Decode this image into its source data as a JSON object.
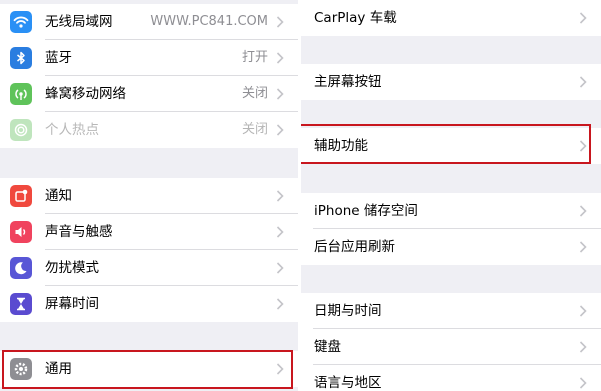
{
  "left": {
    "items": [
      {
        "label": "无线局域网",
        "value": "WWW.PC841.COM",
        "icon": "wifi-icon",
        "color": "#2a90f5"
      },
      {
        "label": "蓝牙",
        "value": "打开",
        "icon": "bluetooth-icon",
        "color": "#2a7de0"
      },
      {
        "label": "蜂窝移动网络",
        "value": "关闭",
        "icon": "cellular-icon",
        "color": "#5fc35a"
      },
      {
        "label": "个人热点",
        "value": "关闭",
        "icon": "hotspot-icon",
        "color": "#bfe5bd"
      },
      {
        "label": "通知",
        "value": "",
        "icon": "notifications-icon",
        "color": "#f0493e"
      },
      {
        "label": "声音与触感",
        "value": "",
        "icon": "sounds-icon",
        "color": "#f0435e"
      },
      {
        "label": "勿扰模式",
        "value": "",
        "icon": "moon-icon",
        "color": "#5856d6"
      },
      {
        "label": "屏幕时间",
        "value": "",
        "icon": "hourglass-icon",
        "color": "#5a4bd0"
      },
      {
        "label": "通用",
        "value": "",
        "icon": "gear-icon",
        "color": "#8e8e93"
      }
    ]
  },
  "right": {
    "items": [
      {
        "label": "CarPlay 车载"
      },
      {
        "label": "主屏幕按钮"
      },
      {
        "label": "辅助功能"
      },
      {
        "label": "iPhone 储存空间"
      },
      {
        "label": "后台应用刷新"
      },
      {
        "label": "日期与时间"
      },
      {
        "label": "键盘"
      },
      {
        "label": "语言与地区"
      }
    ]
  },
  "highlight_color": "#c8161e"
}
